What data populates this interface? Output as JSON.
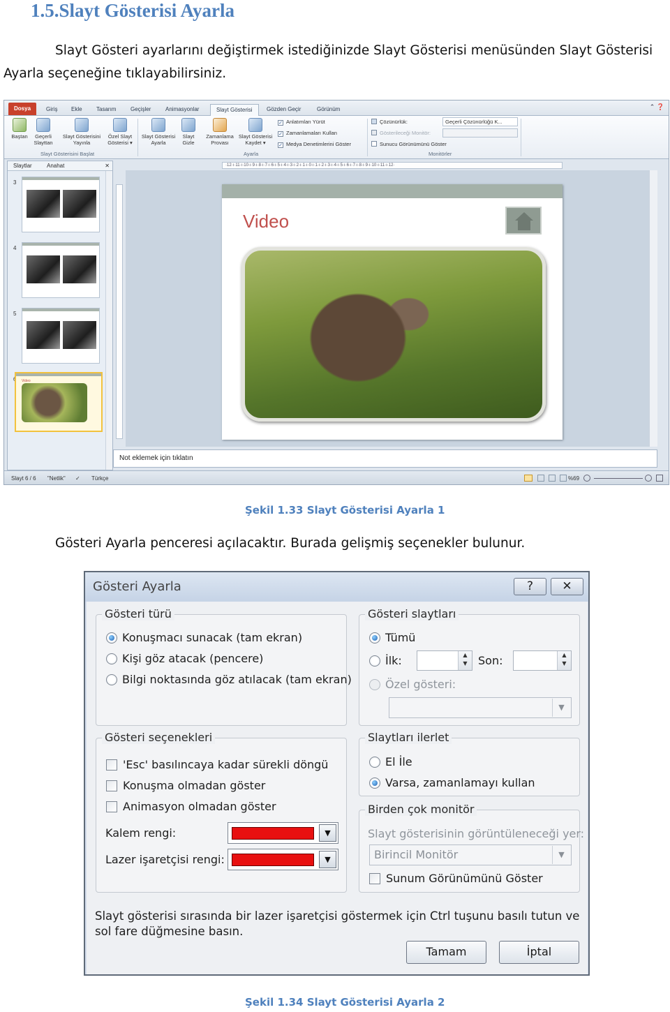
{
  "heading": "1.5.Slayt Gösterisi Ayarla",
  "intro": {
    "line1": "Slayt Gösteri ayarlarını değiştirmek istediğinizde Slayt Gösterisi menüsünden Slayt Gösterisi",
    "line2": "Ayarla seçeneğine tıklayabilirsiniz."
  },
  "ppt": {
    "tabs": [
      "Dosya",
      "Giriş",
      "Ekle",
      "Tasarım",
      "Geçişler",
      "Animasyonlar",
      "Slayt Gösterisi",
      "Gözden Geçir",
      "Görünüm"
    ],
    "win_controls": "⌃ ❓",
    "ribbon": {
      "buttons": [
        {
          "l1": "Baştan",
          "l2": ""
        },
        {
          "l1": "Geçerli",
          "l2": "Slayttan"
        },
        {
          "l1": "Slayt Gösterisini",
          "l2": "Yayınla"
        },
        {
          "l1": "Özel Slayt",
          "l2": "Gösterisi ▾"
        },
        {
          "l1": "Slayt Gösterisi",
          "l2": "Ayarla"
        },
        {
          "l1": "Slayt",
          "l2": "Gizle"
        },
        {
          "l1": "Zamanlama",
          "l2": "Provası"
        },
        {
          "l1": "Slayt Gösterisi",
          "l2": "Kaydet ▾"
        }
      ],
      "group_start": "Slayt Gösterisini Başlat",
      "group_setup": "Ayarla",
      "group_monitors": "Monitörler",
      "checks": [
        "Anlatımları Yürüt",
        "Zamanlamaları Kullan",
        "Medya Denetimlerini Göster"
      ],
      "resolution_label": "Çözünürlük:",
      "resolution_value": "Geçerli Çözünürlüğü K...",
      "show_on_label": "Gösterileceği Monitör:",
      "presenter_view": "Sunucu Görünümünü Göster"
    },
    "pane": {
      "tab_slides": "Slaytlar",
      "tab_outline": "Anahat",
      "close": "✕",
      "thumb_numbers": [
        "3",
        "4",
        "5",
        "6"
      ],
      "thumb6_title": "Video"
    },
    "ruler_text": "·12·ı·11·ı·10·ı·9·ı·8·ı·7·ı·6·ı·5·ı·4·ı·3·ı·2·ı·1·ı·0·ı·1·ı·2·ı·3·ı·4·ı·5·ı·6·ı·7·ı·8·ı·9·ı·10·ı·11·ı·12·",
    "slide_title": "Video",
    "notes_placeholder": "Not eklemek için tıklatın",
    "status": {
      "slide": "Slayt 6 / 6",
      "theme": "\"Netlik\"",
      "language": "Türkçe",
      "zoom": "%69"
    }
  },
  "caption1": "Şekil 1.33 Slayt Gösterisi Ayarla 1",
  "middle_text": "Gösteri Ayarla penceresi açılacaktır. Burada gelişmiş seçenekler bulunur.",
  "dialog": {
    "title": "Gösteri Ayarla",
    "help_button": "?",
    "close_button": "✕",
    "show_type": {
      "label": "Gösteri türü",
      "options": [
        "Konuşmacı sunacak (tam ekran)",
        "Kişi göz atacak (pencere)",
        "Bilgi noktasında göz atılacak (tam ekran)"
      ],
      "selected": 0
    },
    "show_slides": {
      "label": "Gösteri slaytları",
      "all": "Tümü",
      "from": "İlk:",
      "to": "Son:",
      "custom": "Özel gösteri:"
    },
    "show_options": {
      "label": "Gösteri seçenekleri",
      "checks": [
        "'Esc' basılıncaya kadar sürekli döngü",
        "Konuşma olmadan göster",
        "Animasyon olmadan göster"
      ],
      "pen_color_label": "Kalem rengi:",
      "laser_color_label": "Lazer işaretçisi rengi:",
      "pen_color": "#e81010",
      "laser_color": "#e81010"
    },
    "advance": {
      "label": "Slaytları ilerlet",
      "manual": "El İle",
      "timings": "Varsa, zamanlamayı kullan"
    },
    "monitors": {
      "label": "Birden çok monitör",
      "display_on_label": "Slayt gösterisinin görüntüleneceği yer:",
      "display_on_value": "Birincil Monitör",
      "presenter_view": "Sunum Görünümünü Göster"
    },
    "hint": "Slayt gösterisi sırasında bir lazer işaretçisi göstermek için Ctrl tuşunu basılı tutun ve sol fare düğmesine basın.",
    "ok": "Tamam",
    "cancel": "İptal"
  },
  "caption2": "Şekil 1.34 Slayt Gösterisi Ayarla 2"
}
